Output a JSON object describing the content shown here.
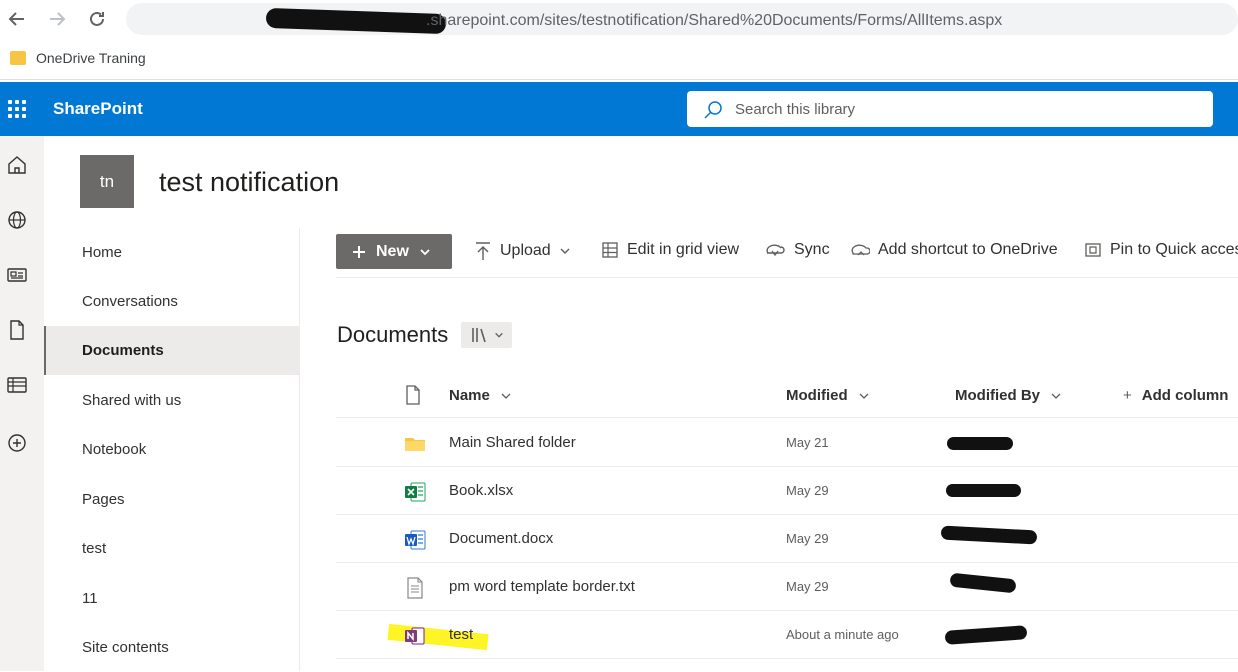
{
  "browser": {
    "url": ".sharepoint.com/sites/testnotification/Shared%20Documents/Forms/AllItems.aspx",
    "bookmark": "OneDrive Traning"
  },
  "suite": {
    "brand": "SharePoint",
    "search_placeholder": "Search this library"
  },
  "site": {
    "logo_initials": "tn",
    "title": "test notification"
  },
  "nav": {
    "items": [
      {
        "label": "Home"
      },
      {
        "label": "Conversations"
      },
      {
        "label": "Documents"
      },
      {
        "label": "Shared with us"
      },
      {
        "label": "Notebook"
      },
      {
        "label": "Pages"
      },
      {
        "label": "test"
      },
      {
        "label": "11"
      },
      {
        "label": "Site contents"
      }
    ],
    "selected": "Documents"
  },
  "commands": {
    "new": "New",
    "upload": "Upload",
    "edit_grid": "Edit in grid view",
    "sync": "Sync",
    "add_shortcut": "Add shortcut to OneDrive",
    "pin": "Pin to Quick acces"
  },
  "library": {
    "title": "Documents",
    "columns": {
      "name": "Name",
      "modified": "Modified",
      "modified_by": "Modified By",
      "add_column": "Add column"
    },
    "rows": [
      {
        "name": "Main Shared folder",
        "modified": "May 21",
        "type": "folder-icon"
      },
      {
        "name": "Book.xlsx",
        "modified": "May 29",
        "type": "excel-icon"
      },
      {
        "name": "Document.docx",
        "modified": "May 29",
        "type": "word-icon"
      },
      {
        "name": "pm word template border.txt",
        "modified": "May 29",
        "type": "text-file-icon"
      },
      {
        "name": "test",
        "modified": "About a minute ago",
        "type": "onenote-icon"
      }
    ]
  },
  "colors": {
    "suite_bar": "#0078d4",
    "accent_gray": "#6b6a69",
    "highlight": "#fff200"
  }
}
